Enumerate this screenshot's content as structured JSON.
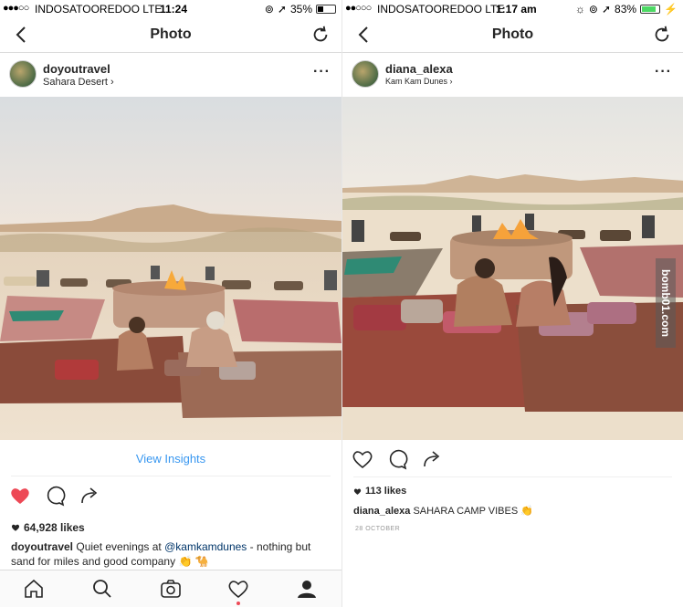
{
  "left": {
    "status": {
      "carrier": "INDOSATOOREDOO LTE",
      "time": "11:24",
      "battery": "35%",
      "battery_level": 0.35
    },
    "nav": {
      "title": "Photo"
    },
    "post": {
      "username": "doyoutravel",
      "location": "Sahara Desert",
      "view_insights": "View Insights",
      "likes": "64,928 likes",
      "caption_user": "doyoutravel",
      "caption_text_1": "Quiet evenings at ",
      "caption_mention": "@kamkamdunes",
      "caption_text_2": " - nothing but sand for miles and good company 👏 🐪",
      "liked": true
    }
  },
  "right": {
    "status": {
      "carrier": "INDOSATOOREDOO LTE",
      "time": "1:17 am",
      "battery": "83%",
      "battery_level": 0.83
    },
    "nav": {
      "title": "Photo"
    },
    "post": {
      "username": "diana_alexa",
      "location": "Kam Kam Dunes",
      "likes": "113 likes",
      "caption_user": "diana_alexa",
      "caption_text": "SAHARA CAMP VIBES 👏",
      "date": "28 OCTOBER",
      "watermark": "bomb01.com"
    }
  },
  "colors": {
    "heart_red": "#ed4956",
    "link_blue": "#3897f0",
    "mention_blue": "#003569"
  }
}
